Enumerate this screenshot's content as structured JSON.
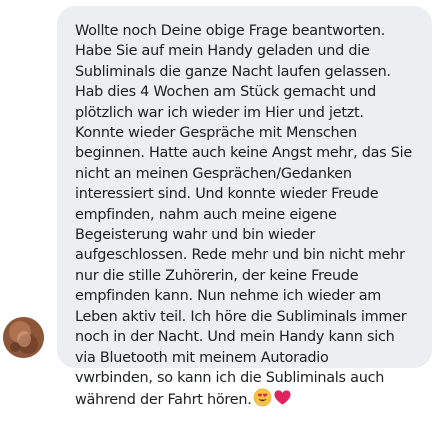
{
  "message": {
    "text": "Wollte noch Deine obige Frage beantworten.\nHabe Sie auf mein Handy geladen und die\nSubliminals die ganze Nacht laufen gelassen.\nHab dies 4 Wochen am Stück gemacht und\nplötzlich war ich wieder im Hier und jetzt.\nKonnte wieder Gespräche mit Menschen\nbeginnen. Hatte auch keine Angst mehr, das Sie\nnicht an meinen Gesprächen/Gedanken\ninteressiert sind. Und konnte wieder Freude\nempfinden, nahm auch meine eigene\nBegeisterung wahr und bin wieder\naufgeschlossen. Rede mehr und bin nicht mehr\nnur die stille Zuhörerin, der keine Freude\nempfinden kann. Nun nehme ich wieder am\nLeben aktiv teil. Ich höre die Subliminals immer\nnoch in der Nacht. Und mein Handy kann sich\nvia Bluetooth mit meinem Autoradio\nvwrbinden, so kann ich die Subliminals auch\nwährend der Fahrt hören.",
    "trailing_emojis": [
      "smiling-face-with-heart-eyes",
      "red-heart"
    ]
  },
  "colors": {
    "bubble": "#eceef1",
    "text": "#1c1e21",
    "heart": "#e0245e"
  }
}
